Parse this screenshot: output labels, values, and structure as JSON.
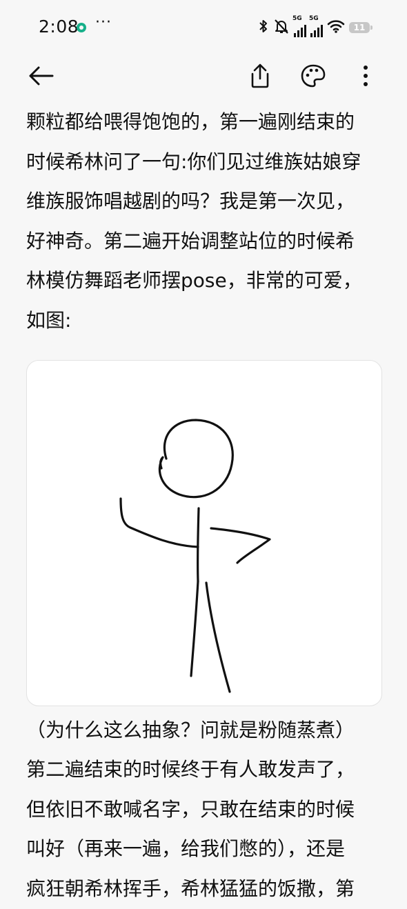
{
  "status_bar": {
    "time": "2:08",
    "more": "···",
    "network_tags": [
      "5G",
      "5G"
    ],
    "battery_level": "11"
  },
  "toolbar": {
    "back_icon": "arrow-left-icon",
    "share_icon": "share-icon",
    "theme_icon": "palette-icon",
    "menu_icon": "more-vertical-icon"
  },
  "article": {
    "lines_before_image": [
      "颗粒都给喂得饱饱的，第一遍刚结束的",
      "时候希林问了一句:你们见过维族姑娘穿",
      "维族服饰唱越剧的吗？我是第一次见，",
      "好神奇。第二遍开始调整站位的时候希",
      "林模仿舞蹈老师摆pose，非常的可爱，",
      "如图:"
    ],
    "lines_after_image": [
      "（为什么这么抽象？问就是粉随蒸煮）",
      "第二遍结束的时候终于有人敢发声了，",
      "但依旧不敢喊名字，只敢在结束的时候",
      "叫好（再来一遍，给我们憋的），还是",
      "疯狂朝希林挥手，希林猛猛的饭撒，第"
    ]
  },
  "colors": {
    "background": "#f7f7f7",
    "text": "#111111",
    "card": "#ffffff",
    "accent_dot": "#17b08a",
    "battery": "#c7c7c7"
  }
}
